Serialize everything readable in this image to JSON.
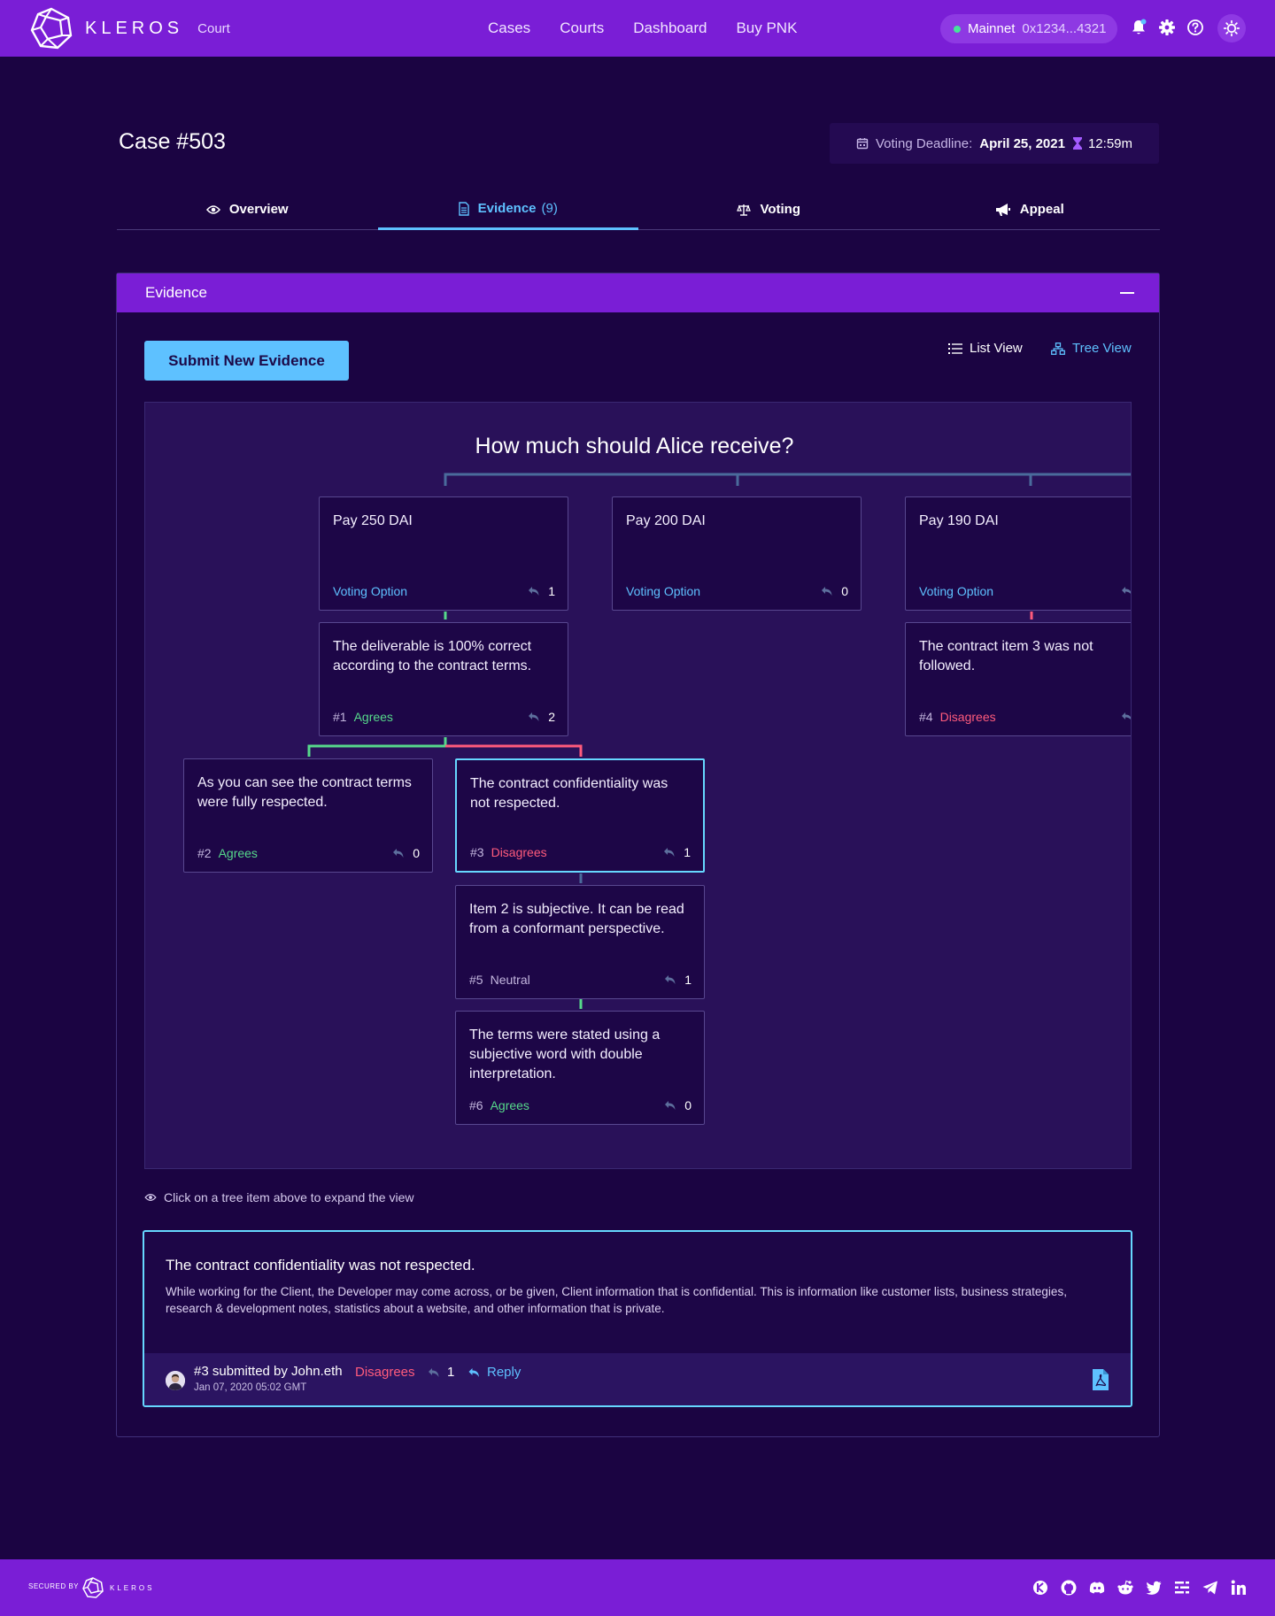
{
  "app": {
    "brand": "KLEROS",
    "product": "Court"
  },
  "nav": [
    "Cases",
    "Courts",
    "Dashboard",
    "Buy PNK"
  ],
  "wallet": {
    "network": "Mainnet",
    "address": "0x1234...4321"
  },
  "case": {
    "title": "Case #503",
    "deadline_label": "Voting Deadline:",
    "deadline_date": "April 25, 2021",
    "deadline_time": "12:59m"
  },
  "tabs": {
    "overview": "Overview",
    "evidence": "Evidence",
    "evidence_count": "(9)",
    "voting": "Voting",
    "appeal": "Appeal"
  },
  "panel": {
    "title": "Evidence",
    "submit_label": "Submit New Evidence",
    "list_view": "List View",
    "tree_view": "Tree View",
    "question": "How much should Alice receive?",
    "hint": "Click on a tree item above to expand the view"
  },
  "options": [
    {
      "text": "Pay 250 DAI",
      "tag": "Voting Option",
      "replies": "1"
    },
    {
      "text": "Pay 200 DAI",
      "tag": "Voting Option",
      "replies": "0"
    },
    {
      "text": "Pay 190 DAI",
      "tag": "Voting Option",
      "replies": ""
    }
  ],
  "evidence": [
    {
      "num": "#1",
      "stance": "Agrees",
      "text": "The deliverable is 100% correct according to the contract terms.",
      "replies": "2"
    },
    {
      "num": "#2",
      "stance": "Agrees",
      "text": "As you can see the contract terms were fully respected.",
      "replies": "0"
    },
    {
      "num": "#3",
      "stance": "Disagrees",
      "text": "The contract confidentiality was not respected.",
      "replies": "1"
    },
    {
      "num": "#4",
      "stance": "Disagrees",
      "text": "The contract item 3 was not followed.",
      "replies": ""
    },
    {
      "num": "#5",
      "stance": "Neutral",
      "text": "Item 2 is subjective. It can be read from a conformant perspective.",
      "replies": "1"
    },
    {
      "num": "#6",
      "stance": "Agrees",
      "text": "The terms were stated using a subjective word with double interpretation.",
      "replies": "0"
    }
  ],
  "detail": {
    "title": "The contract confidentiality was not respected.",
    "body": "While working for the Client, the Developer may come across, or be given, Client information that is confidential. This is information like customer lists, business strategies, research & development notes, statistics about a website, and other information that is private.",
    "submitter": "#3 submitted by John.eth",
    "date": "Jan 07, 2020 05:02 GMT",
    "stance": "Disagrees",
    "replies": "1",
    "reply_label": "Reply"
  },
  "footer": {
    "secured_by": "SECURED BY",
    "brand": "KLEROS"
  },
  "colors": {
    "primary": "#7a1ed6",
    "background": "#1b0442",
    "accent": "#5ec1ff",
    "agree": "#56d98b",
    "disagree": "#ff5b7c"
  },
  "icons": [
    "kleros-logo",
    "bell-icon",
    "gear-icon",
    "help-icon",
    "sun-icon",
    "calendar-icon",
    "hourglass-icon",
    "eye-icon",
    "document-icon",
    "scale-icon",
    "megaphone-icon",
    "list-icon",
    "tree-icon",
    "reply-icon",
    "pdf-icon",
    "kleros-community-icon",
    "github-icon",
    "discord-icon",
    "reddit-icon",
    "twitter-icon",
    "ghost-icon",
    "telegram-icon",
    "linkedin-icon"
  ]
}
